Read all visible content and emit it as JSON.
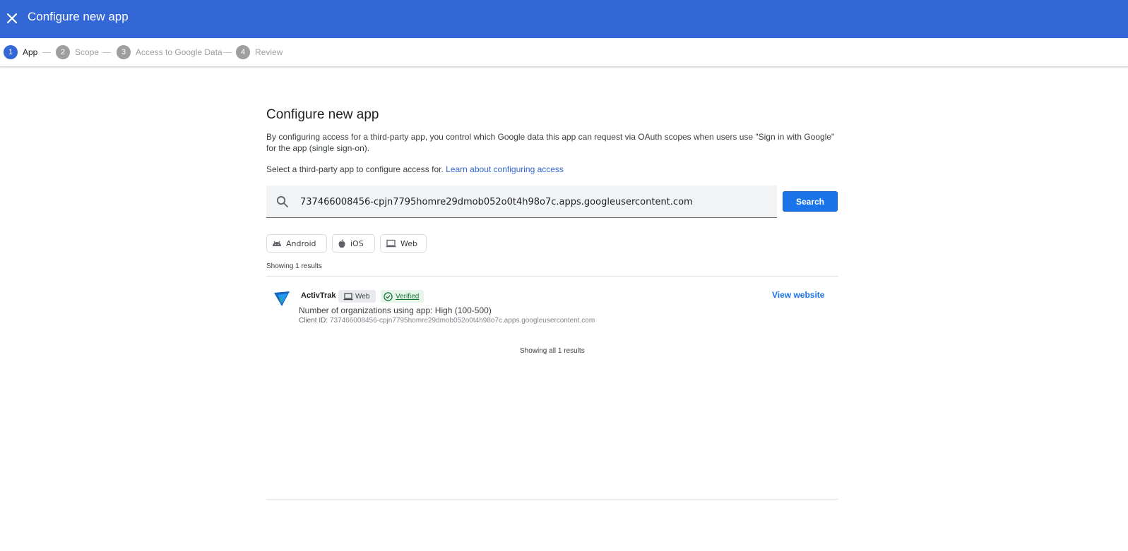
{
  "header": {
    "title": "Configure new app",
    "bar_color": "#3367d6"
  },
  "stepper": {
    "steps": [
      {
        "number": "1",
        "label": "App",
        "active": true
      },
      {
        "number": "2",
        "label": "Scope",
        "active": false
      },
      {
        "number": "3",
        "label": "Access to Google Data",
        "active": false
      },
      {
        "number": "4",
        "label": "Review",
        "active": false
      }
    ]
  },
  "main": {
    "title": "Configure new app",
    "description": "By configuring access for a third-party app, you control which Google data this app can request via OAuth scopes when users use \"Sign in with Google\" for the app (single sign-on).",
    "select_text": "Select a third-party app to configure access for.",
    "learn_link": "Learn about configuring access",
    "search": {
      "value": "737466008456-cpjn7795homre29dmob052o0t4h98o7c.apps.googleusercontent.com",
      "button_label": "Search"
    },
    "filters": [
      {
        "label": "Android",
        "icon": "android-icon"
      },
      {
        "label": "iOS",
        "icon": "apple-icon"
      },
      {
        "label": "Web",
        "icon": "laptop-icon"
      }
    ],
    "results_count_text": "Showing 1 results",
    "result": {
      "name": "ActivTrak",
      "platform_badge": "Web",
      "verified_badge": "Verified",
      "orgs_text": "Number of organizations using app: High (100-500)",
      "client_id_label": "Client ID:",
      "client_id_value": "737466008456-cpjn7795homre29dmob052o0t4h98o7c.apps.googleusercontent.com",
      "view_website": "View website"
    },
    "results_footer": "Showing all 1 results"
  }
}
